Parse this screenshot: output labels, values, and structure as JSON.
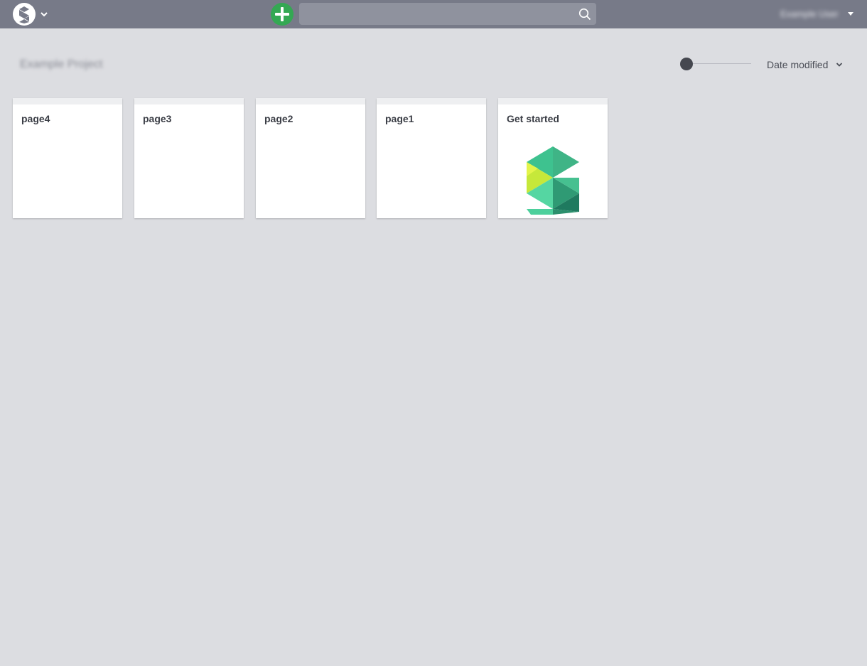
{
  "header": {
    "search": {
      "value": "",
      "placeholder": ""
    },
    "user": {
      "name": "Example User"
    }
  },
  "toolbar": {
    "project_title": "Example Project",
    "zoom_level": 0,
    "sort": {
      "selected": "Date modified"
    }
  },
  "pages": [
    {
      "title": "page4"
    },
    {
      "title": "page3"
    },
    {
      "title": "page2"
    },
    {
      "title": "page1"
    },
    {
      "title": "Get started"
    }
  ],
  "colors": {
    "topbar": "#777a88",
    "background": "#dcdde1",
    "add_button": "#34a853",
    "logo_green": "#3ec28f",
    "logo_lime": "#c6e83a"
  },
  "icons": {
    "app_logo": "app-logo-icon",
    "add": "plus-circle-icon",
    "search": "search-icon",
    "sort": "chevron-down-icon"
  }
}
